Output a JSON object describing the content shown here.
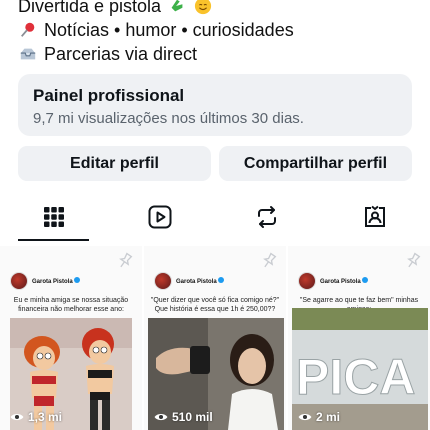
{
  "bio": {
    "line1": "Divertida e pistola",
    "line2": "Notícias • humor • curiosidades",
    "line3": "Parcerias via direct",
    "icons": [
      "hand-icon",
      "smile-icon",
      "pushpin-icon",
      "inbox-icon"
    ]
  },
  "panel": {
    "title": "Painel profissional",
    "subtitle": "9,7 mi visualizações nos últimos 30 dias."
  },
  "buttons": {
    "edit": "Editar perfil",
    "share": "Compartilhar perfil"
  },
  "tabs": [
    "grid-icon",
    "reels-icon",
    "reposts-icon",
    "tagged-icon"
  ],
  "posts": [
    {
      "author": "Garota Pistola",
      "text": "Eu e minha amiga se nossa situação financeira não melhorar esse ano:",
      "views": "1,3 mi"
    },
    {
      "author": "Garota Pistola",
      "text": "\"Quer dizer que você só fica comigo né?\" Que história é essa que 1h é 250,00??",
      "views": "510 mil"
    },
    {
      "author": "Garota Pistola",
      "text": "\"Se agarre ao que te faz bem\" minhas amigas:",
      "views": "2 mi",
      "image_text": "PICA"
    }
  ],
  "colors": {
    "panel_bg": "#eff1f4",
    "text": "#0f1419",
    "muted": "#5a636d",
    "verified": "#1d9bf0"
  }
}
